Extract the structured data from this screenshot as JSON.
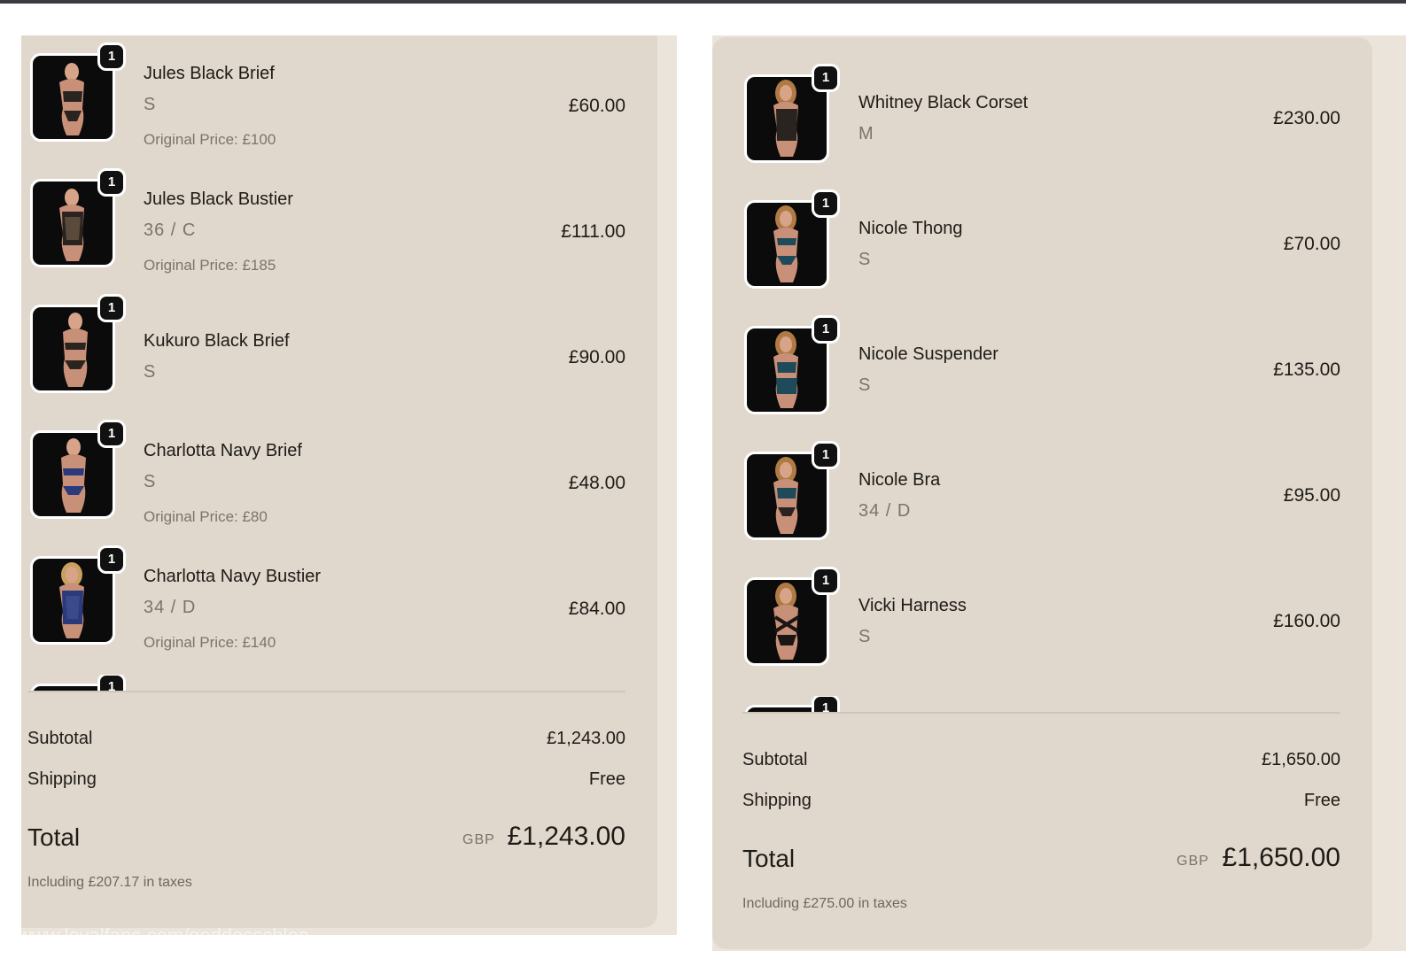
{
  "left_cart": {
    "items": [
      {
        "qty": "1",
        "name": "Jules Black Brief",
        "variant": "S",
        "original_price": "Original Price: £100",
        "price": "£60.00"
      },
      {
        "qty": "1",
        "name": "Jules Black Bustier",
        "variant": "36 / C",
        "original_price": "Original Price: £185",
        "price": "£111.00"
      },
      {
        "qty": "1",
        "name": "Kukuro Black Brief",
        "variant": "S",
        "original_price": "",
        "price": "£90.00"
      },
      {
        "qty": "1",
        "name": "Charlotta Navy Brief",
        "variant": "S",
        "original_price": "Original Price: £80",
        "price": "£48.00"
      },
      {
        "qty": "1",
        "name": "Charlotta Navy Bustier",
        "variant": "34 / D",
        "original_price": "Original Price: £140",
        "price": "£84.00"
      }
    ],
    "peek_qty": "1",
    "subtotal_label": "Subtotal",
    "subtotal": "£1,243.00",
    "shipping_label": "Shipping",
    "shipping": "Free",
    "total_label": "Total",
    "currency": "GBP",
    "total": "£1,243.00",
    "tax_note": "Including £207.17 in taxes"
  },
  "right_cart": {
    "items": [
      {
        "qty": "1",
        "name": "Whitney Black Corset",
        "variant": "M",
        "price": "£230.00"
      },
      {
        "qty": "1",
        "name": "Nicole Thong",
        "variant": "S",
        "price": "£70.00"
      },
      {
        "qty": "1",
        "name": "Nicole Suspender",
        "variant": "S",
        "price": "£135.00"
      },
      {
        "qty": "1",
        "name": "Nicole Bra",
        "variant": "34 / D",
        "price": "£95.00"
      },
      {
        "qty": "1",
        "name": "Vicki Harness",
        "variant": "S",
        "price": "£160.00"
      }
    ],
    "peek_qty": "1",
    "subtotal_label": "Subtotal",
    "subtotal": "£1,650.00",
    "shipping_label": "Shipping",
    "shipping": "Free",
    "total_label": "Total",
    "currency": "GBP",
    "total": "£1,650.00",
    "tax_note": "Including £275.00 in taxes"
  },
  "watermark": "www.loyalfans.com/goddesschloe",
  "colors": {
    "panel": "#e0d8cc",
    "panel_edge": "#ebe4da",
    "text": "#1e1b17",
    "muted": "#7c746b",
    "badge": "#111111",
    "thumb_bg": "#0b0b0b"
  }
}
